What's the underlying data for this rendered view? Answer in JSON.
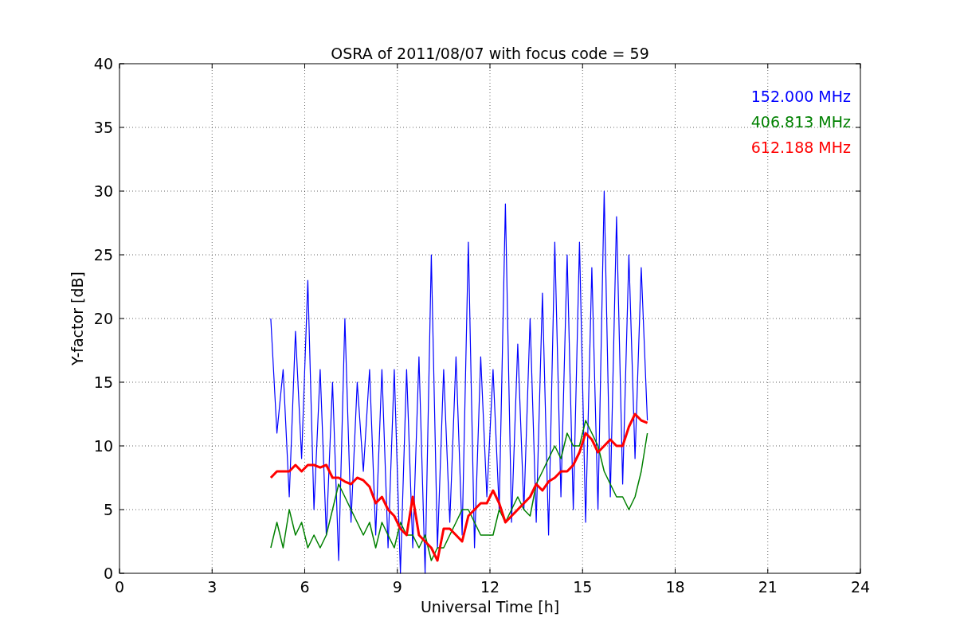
{
  "chart_data": {
    "type": "line",
    "title": "OSRA of 2011/08/07 with focus code = 59",
    "xlabel": "Universal Time [h]",
    "ylabel": "Y-factor [dB]",
    "x": [
      4.9,
      5.1,
      5.3,
      5.5,
      5.7,
      5.9,
      6.1,
      6.3,
      6.5,
      6.7,
      6.9,
      7.1,
      7.3,
      7.5,
      7.7,
      7.9,
      8.1,
      8.3,
      8.5,
      8.7,
      8.9,
      9.1,
      9.3,
      9.5,
      9.7,
      9.9,
      10.1,
      10.3,
      10.5,
      10.7,
      10.9,
      11.1,
      11.3,
      11.5,
      11.7,
      11.9,
      12.1,
      12.3,
      12.5,
      12.7,
      12.9,
      13.1,
      13.3,
      13.5,
      13.7,
      13.9,
      14.1,
      14.3,
      14.5,
      14.7,
      14.9,
      15.1,
      15.3,
      15.5,
      15.7,
      15.9,
      16.1,
      16.3,
      16.5,
      16.7,
      16.9,
      17.1
    ],
    "series": [
      {
        "name": "152.000 MHz",
        "color": "#0000ff",
        "values": [
          20,
          11,
          16,
          6,
          19,
          9,
          23,
          5,
          16,
          3,
          15,
          1,
          20,
          4,
          15,
          8,
          16,
          3,
          16,
          2,
          16,
          0,
          16,
          2,
          17,
          0,
          25,
          2,
          16,
          4,
          17,
          3,
          26,
          2,
          17,
          6,
          16,
          5,
          29,
          4,
          18,
          5,
          20,
          4,
          22,
          3,
          26,
          6,
          25,
          5,
          26,
          4,
          24,
          5,
          30,
          6,
          28,
          7,
          25,
          9,
          24,
          12
        ]
      },
      {
        "name": "406.813 MHz",
        "color": "#008000",
        "values": [
          2,
          4,
          2,
          5,
          3,
          4,
          2,
          3,
          2,
          3,
          5,
          7,
          6,
          5,
          4,
          3,
          4,
          2,
          4,
          3,
          2,
          4,
          3,
          3,
          2,
          3,
          1,
          2,
          2,
          3,
          4,
          5,
          5,
          4,
          3,
          3,
          3,
          5,
          4,
          5,
          6,
          5,
          4.5,
          7,
          8,
          9,
          10,
          9,
          11,
          10,
          10,
          12,
          11,
          10,
          8,
          7,
          6,
          6,
          5,
          6,
          8,
          11
        ]
      },
      {
        "name": "612.188 MHz",
        "color": "#ff0000",
        "values": [
          7.5,
          8,
          8,
          8,
          8.5,
          8,
          8.5,
          8.5,
          8.3,
          8.5,
          7.5,
          7.5,
          7.2,
          7,
          7.5,
          7.3,
          6.8,
          5.5,
          6,
          5,
          4.5,
          3.5,
          3,
          6,
          3,
          2.5,
          2,
          1,
          3.5,
          3.5,
          3,
          2.5,
          4.5,
          5,
          5.5,
          5.5,
          6.5,
          5.5,
          4,
          4.5,
          5,
          5.5,
          6,
          7,
          6.5,
          7.2,
          7.5,
          8,
          8,
          8.5,
          9.5,
          11,
          10.5,
          9.5,
          10,
          10.5,
          10,
          10,
          11.5,
          12.5,
          12,
          11.8
        ]
      }
    ],
    "grid": true,
    "xlim": [
      0,
      24
    ],
    "ylim": [
      0,
      40
    ],
    "xticks": [
      0,
      3,
      6,
      9,
      12,
      15,
      18,
      21,
      24
    ],
    "yticks": [
      0,
      5,
      10,
      15,
      20,
      25,
      30,
      35,
      40
    ]
  }
}
